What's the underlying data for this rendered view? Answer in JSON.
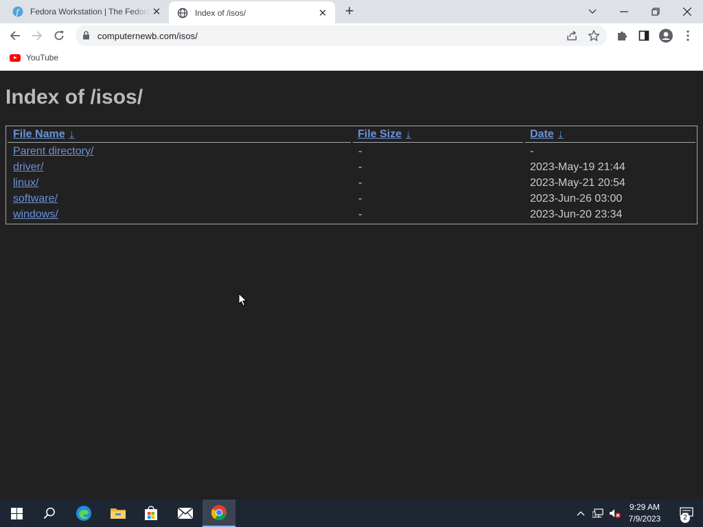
{
  "browser": {
    "tabs": [
      {
        "title": "Fedora Workstation | The Fedora Project",
        "favicon": "fedora-icon",
        "active": false
      },
      {
        "title": "Index of /isos/",
        "favicon": "globe-icon",
        "active": true
      }
    ],
    "url": "computernewb.com/isos/",
    "bookmarks": [
      {
        "label": "YouTube",
        "icon": "youtube-icon"
      }
    ]
  },
  "page": {
    "heading": "Index of /isos/",
    "columns": [
      {
        "label": "File Name",
        "sort_arrow": "↓"
      },
      {
        "label": "File Size",
        "sort_arrow": "↓"
      },
      {
        "label": "Date",
        "sort_arrow": "↓"
      }
    ],
    "rows": [
      {
        "name": "Parent directory/",
        "size": "-",
        "date": "-"
      },
      {
        "name": "driver/",
        "size": "-",
        "date": "2023-May-19 21:44"
      },
      {
        "name": "linux/",
        "size": "-",
        "date": "2023-May-21 20:54"
      },
      {
        "name": "software/",
        "size": "-",
        "date": "2023-Jun-26 03:00"
      },
      {
        "name": "windows/",
        "size": "-",
        "date": "2023-Jun-20 23:34"
      }
    ]
  },
  "taskbar": {
    "pinned": [
      "start-icon",
      "search-icon",
      "edge-icon",
      "file-explorer-icon",
      "store-icon",
      "mail-icon",
      "chrome-icon"
    ],
    "time": "9:29 AM",
    "date": "7/9/2023",
    "notification_count": "2"
  },
  "colors": {
    "page_background": "#212121",
    "heading": "#bbbbbb",
    "link": "#6c93d8",
    "text": "#cccccc"
  }
}
